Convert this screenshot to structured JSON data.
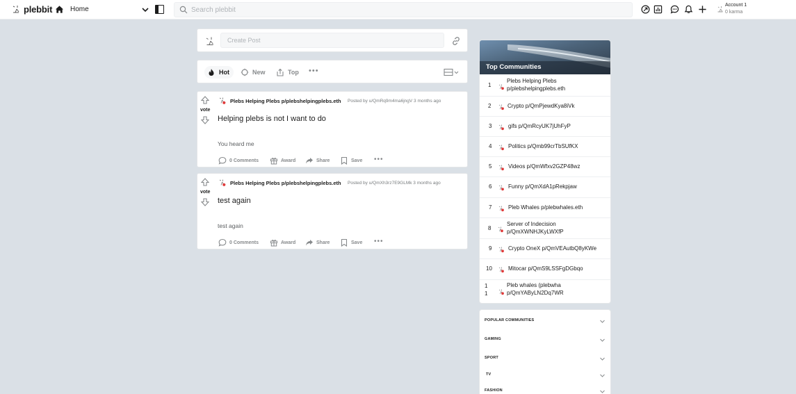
{
  "header": {
    "brand": "plebbit",
    "home_label": "Home",
    "search_placeholder": "Search plebbit",
    "account_name": "Account 1",
    "account_karma": "0 karma"
  },
  "create_post": {
    "placeholder": "Create Post"
  },
  "sort": {
    "options": [
      "Hot",
      "New",
      "Top"
    ],
    "active": "Hot"
  },
  "posts": [
    {
      "vote_label": "vote",
      "subplebbit": "Plebs Helping Plebs p/plebshelpingplebs.eth",
      "posted_by": "Posted by u/QmRq9m4ma6jngV 3 months ago",
      "title": "Helping plebs is not I want to do",
      "body": "You heard me",
      "comments": "0 Comments",
      "award": "Award",
      "share": "Share",
      "save": "Save"
    },
    {
      "vote_label": "vote",
      "subplebbit": "Plebs Helping Plebs p/plebshelpingplebs.eth",
      "posted_by": "Posted by u/QmXh3rz7E9GLMk 3 months ago",
      "title": "test again",
      "body": "test again",
      "comments": "0 Comments",
      "award": "Award",
      "share": "Share",
      "save": "Save"
    }
  ],
  "top_communities": {
    "title": "Top Communities",
    "items": [
      {
        "rank": "1",
        "line1": "Plebs Helping Plebs",
        "line2": "p/plebshelpingplebs.eth"
      },
      {
        "rank": "2",
        "line1": "Crypto p/QmPjewdKya8iVk",
        "line2": ""
      },
      {
        "rank": "3",
        "line1": "gifs p/QmRcyUK7jUhFyP",
        "line2": ""
      },
      {
        "rank": "4",
        "line1": "Politics p/Qmb99crTbSUfKX",
        "line2": ""
      },
      {
        "rank": "5",
        "line1": "Videos p/QmWfxv2GZP48wz",
        "line2": ""
      },
      {
        "rank": "6",
        "line1": "Funny p/QmXdA1pRekpjaw",
        "line2": ""
      },
      {
        "rank": "7",
        "line1": "Pleb Whales p/plebwhales.eth",
        "line2": ""
      },
      {
        "rank": "8",
        "line1": "Server of Indecision",
        "line2": "p/QmXWNHJKyLWXfP"
      },
      {
        "rank": "9",
        "line1": "Crypto OneX p/QmVEAutbQ8yKWe",
        "line2": ""
      },
      {
        "rank": "10",
        "line1": "Mitocar p/QmS9LSSFgDGbqo",
        "line2": ""
      },
      {
        "rank": "1\n1",
        "line1": "Pleb whales (plebwha",
        "line2": "p/QmYAByLN2Dq7WR"
      }
    ]
  },
  "categories": [
    "POPULAR COMMUNITIES",
    "GAMING",
    "SPORT",
    "TV",
    "FASHION"
  ]
}
